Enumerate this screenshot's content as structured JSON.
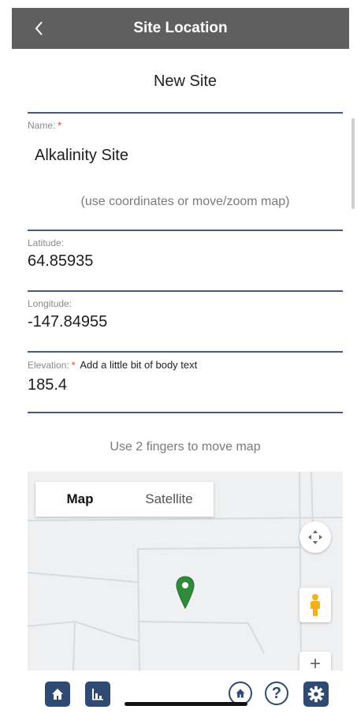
{
  "header": {
    "title": "Site Location",
    "back_icon": "chevron-left-icon"
  },
  "form": {
    "heading": "New Site",
    "name_label": "Name:",
    "name_required": "*",
    "name_value": "Alkalinity Site",
    "coords_hint": "(use coordinates or move/zoom map)",
    "latitude_label": "Latitude:",
    "latitude_value": "64.85935",
    "longitude_label": "Longitude:",
    "longitude_value": "-147.84955",
    "elevation_label": "Elevation:",
    "elevation_required": "*",
    "elevation_note": "Add a little bit of body text",
    "elevation_value": "185.4"
  },
  "map": {
    "hint": "Use 2 fingers to move map",
    "map_type_options": [
      "Map",
      "Satellite"
    ],
    "selected_map_type": "Map",
    "zoom_in_label": "+",
    "marker_color": "#2e8b3a"
  },
  "bottom_nav": {
    "help_label": "?",
    "accent_color": "#2f4a73"
  }
}
